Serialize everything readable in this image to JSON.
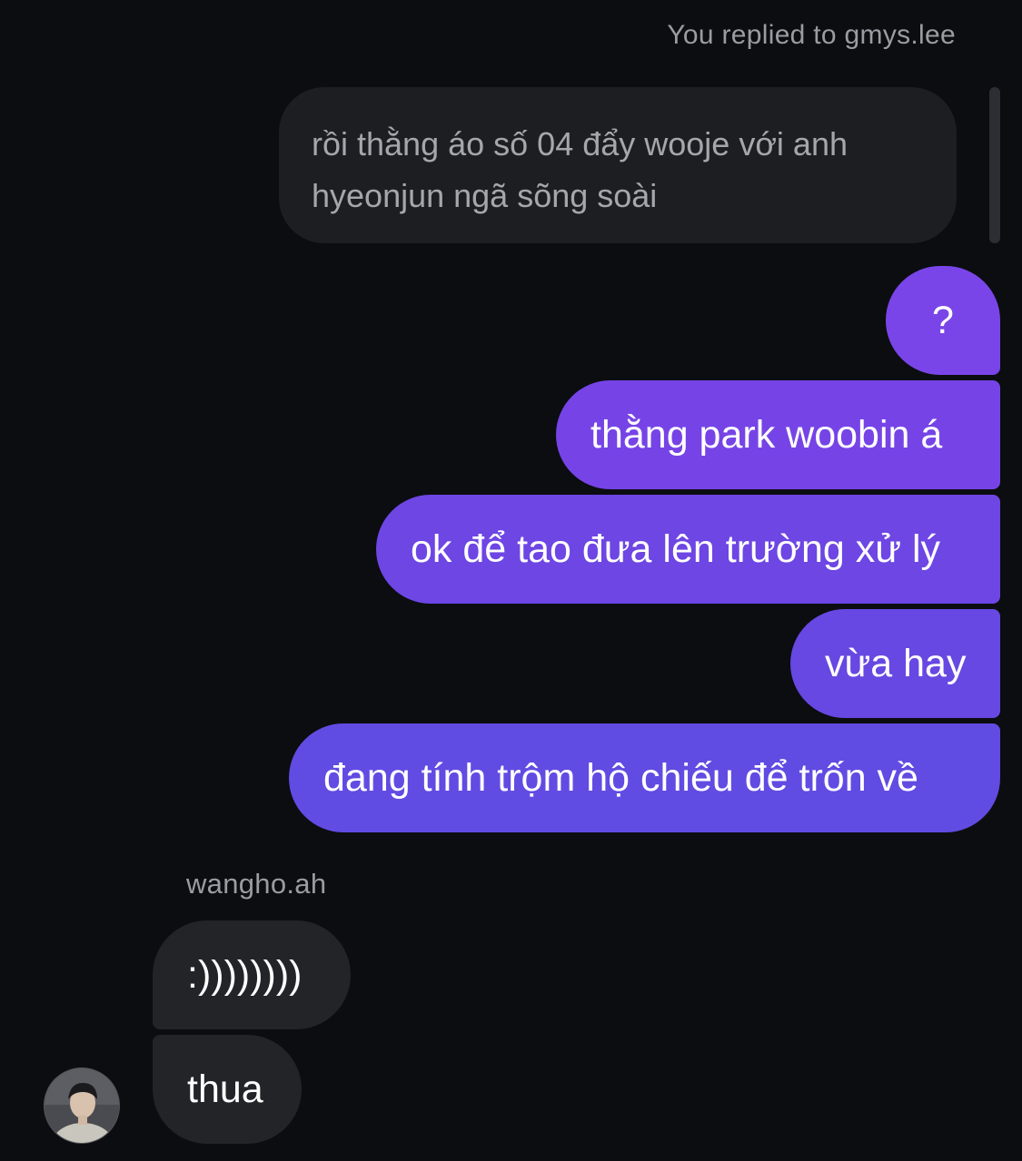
{
  "reply": {
    "label": "You replied to gmys.lee",
    "quoted_line1": "rồi thằng áo số 04 đẩy wooje với anh",
    "quoted_line2": "hyeonjun ngã sõng soài"
  },
  "outgoing_messages": [
    "?",
    "thằng park woobin á",
    "ok để tao đưa lên trường xử lý",
    "vừa hay",
    "đang tính trộm hộ chiếu để trốn về"
  ],
  "incoming": {
    "sender": "wangho.ah",
    "messages": [
      ":))))))))",
      "thua"
    ],
    "avatar_icon": "user-avatar-photo"
  },
  "colors": {
    "background": "#0b0d10",
    "outgoing_gradient_top": "#7a45e8",
    "outgoing_gradient_bottom": "#604ce2",
    "incoming_bubble": "#222428",
    "reply_bubble": "#1c1e22",
    "meta_text": "#9a9ca3"
  }
}
